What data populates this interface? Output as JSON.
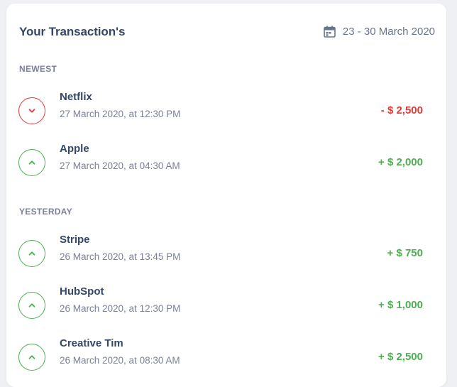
{
  "header": {
    "title": "Your Transaction's",
    "date_range": "23 - 30 March 2020",
    "calendar_icon": "calendar-icon"
  },
  "colors": {
    "negative": "#e53935",
    "positive": "#4caf50",
    "heading": "#344767",
    "muted": "#7b809a"
  },
  "sections": [
    {
      "label": "NEWEST",
      "items": [
        {
          "name": "Netflix",
          "time": "27 March 2020, at 12:30 PM",
          "amount": "- $ 2,500",
          "direction": "down"
        },
        {
          "name": "Apple",
          "time": "27 March 2020, at 04:30 AM",
          "amount": "+ $ 2,000",
          "direction": "up"
        }
      ]
    },
    {
      "label": "YESTERDAY",
      "items": [
        {
          "name": "Stripe",
          "time": "26 March 2020, at 13:45 PM",
          "amount": "+ $ 750",
          "direction": "up"
        },
        {
          "name": "HubSpot",
          "time": "26 March 2020, at 12:30 PM",
          "amount": "+ $ 1,000",
          "direction": "up"
        },
        {
          "name": "Creative Tim",
          "time": "26 March 2020, at 08:30 AM",
          "amount": "+ $ 2,500",
          "direction": "up"
        }
      ]
    }
  ]
}
